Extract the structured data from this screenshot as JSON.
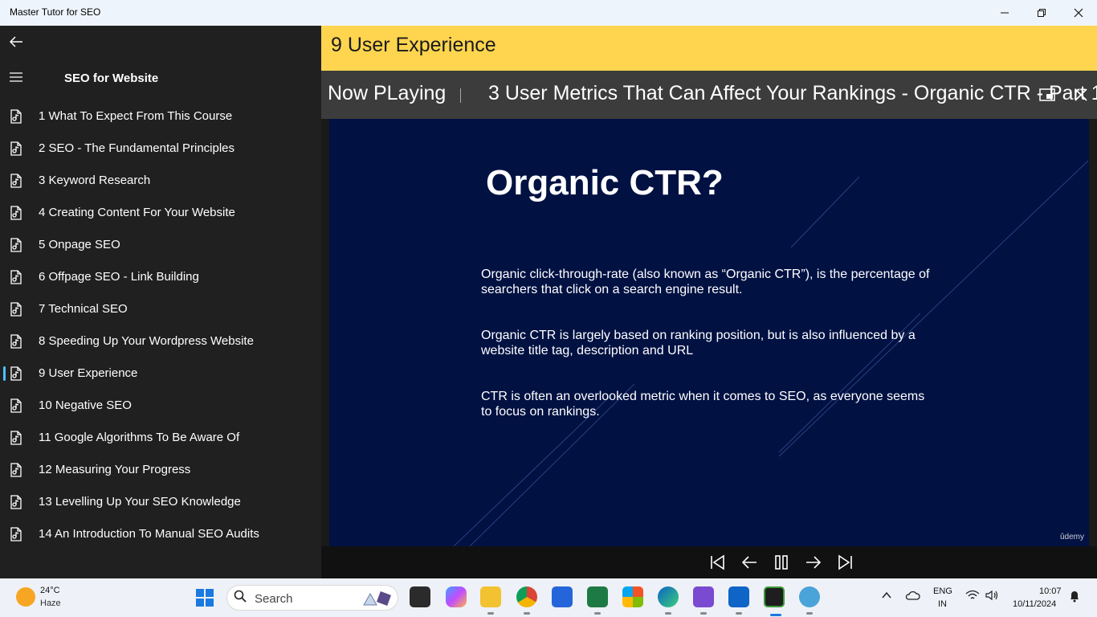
{
  "window": {
    "title": "Master Tutor for SEO"
  },
  "sidebar": {
    "title": "SEO for Website",
    "items": [
      {
        "label": "1 What To Expect From This Course"
      },
      {
        "label": "2 SEO - The Fundamental Principles"
      },
      {
        "label": "3 Keyword Research"
      },
      {
        "label": "4 Creating Content For Your Website"
      },
      {
        "label": "5 Onpage SEO"
      },
      {
        "label": "6 Offpage SEO - Link Building"
      },
      {
        "label": "7 Technical SEO"
      },
      {
        "label": "8 Speeding Up Your Wordpress Website"
      },
      {
        "label": "9 User Experience"
      },
      {
        "label": "10 Negative SEO"
      },
      {
        "label": "11 Google Algorithms To Be Aware Of"
      },
      {
        "label": "12 Measuring Your Progress"
      },
      {
        "label": "13 Levelling Up Your SEO Knowledge"
      },
      {
        "label": "14 An Introduction To Manual SEO Audits"
      }
    ],
    "selected_item": "9 User Experience"
  },
  "header": {
    "title": "9 User Experience"
  },
  "now_playing": {
    "label": "Now PLaying",
    "track": "3 User Metrics That Can Affect Your Rankings - Organic CTR - Part 1"
  },
  "slide": {
    "title": "Organic CTR?",
    "para1": "Organic click-through-rate (also known as “Organic CTR”), is the percentage of searchers that click on a search engine result.",
    "para2": "Organic CTR is largely based on ranking position, but is also influenced by a website title tag, description and URL",
    "para3": "CTR is often an overlooked metric when it comes to SEO, as everyone seems to focus on rankings.",
    "watermark": "ûdemy"
  },
  "taskbar": {
    "weather_temp": "24°C",
    "weather_desc": "Haze",
    "search_placeholder": "Search",
    "lang1": "ENG",
    "lang2": "IN",
    "time": "10:07",
    "date": "10/11/2024"
  },
  "colors": {
    "header_bg": "#ffd54f",
    "slide_bg": "#001142",
    "sidebar_bg": "#202020",
    "selection_accent": "#4cc2ff"
  }
}
